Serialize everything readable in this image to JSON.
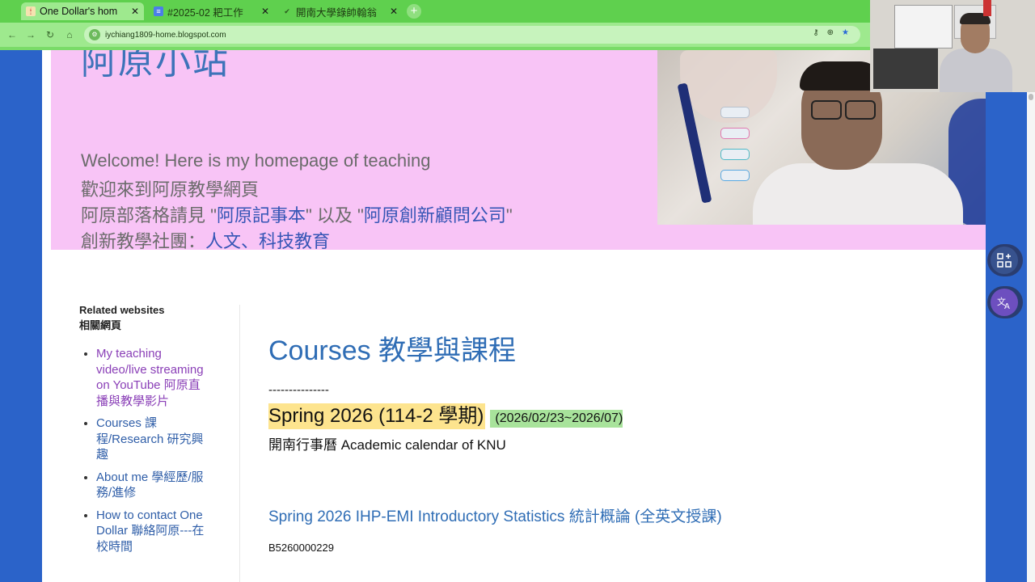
{
  "browser": {
    "tabs": [
      {
        "title": "One Dollar's hom",
        "active": true
      },
      {
        "title": "#2025-02 耙工作",
        "active": false
      },
      {
        "title": "開南大學錄帥翰翁",
        "active": false
      }
    ],
    "url": "iychiang1809-home.blogspot.com",
    "colors": {
      "tabbar": "#5fd04e",
      "toolbar": "#9ee98e"
    }
  },
  "header": {
    "site_title": "阿原小站",
    "welcome": "Welcome! Here is my homepage of teaching",
    "welcome_zh": "歡迎來到阿原教學網頁",
    "blog_prefix": "阿原部落格請見 \"",
    "blog_link1": "阿原記事本",
    "blog_mid": "\" 以及 \"",
    "blog_link2": "阿原創新顧問公司",
    "blog_suffix": "\"",
    "community_prefix": "創新教學社團：",
    "community_link": "人文、科技教育",
    "background_color": "#f8c4f6"
  },
  "sidebar": {
    "heading_en": "Related websites",
    "heading_zh": "相關網頁",
    "items": [
      {
        "label": "My teaching video/live streaming on YouTube 阿原直播與教學影片",
        "visited": true
      },
      {
        "label": "Courses 課程/Research 研究興趣",
        "visited": false
      },
      {
        "label": "About me 學經歷/服務/進修",
        "visited": false
      },
      {
        "label": "How to contact One Dollar 聯絡阿原---在校時間",
        "visited": false
      }
    ]
  },
  "main": {
    "heading": "Courses 教學與課程",
    "separator": "---------------",
    "semester": "Spring 2026 (114-2 學期)",
    "semester_range": "(2026/02/23~2026/07)",
    "calendar": "開南行事曆  Academic calendar of KNU",
    "course_title": "Spring 2026 IHP-EMI Introductory Statistics 統計概論 (全英文授課)",
    "course_code": "B5260000229"
  },
  "floating": {
    "apps_icon": "grid-apps-icon",
    "translate_icon": "translate-icon"
  }
}
